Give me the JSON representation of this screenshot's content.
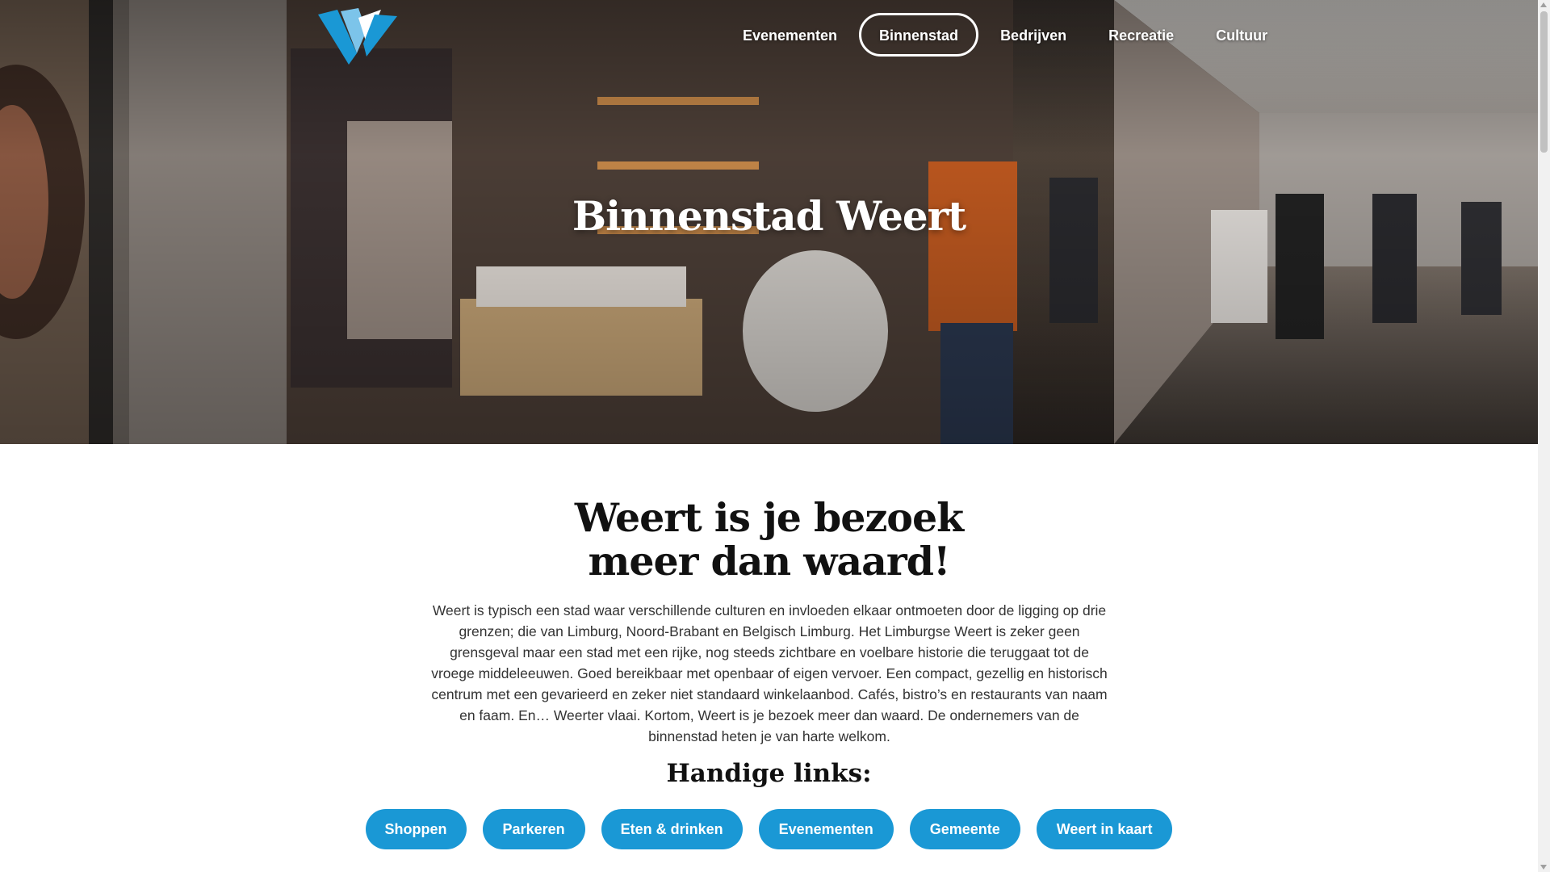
{
  "hero": {
    "title": "Binnenstad Weert",
    "image": "shopping-street-photo"
  },
  "logo": {
    "icon": "weert-w-logo",
    "colors": [
      "#1a98d5",
      "#7cc4ea",
      "#ffffff"
    ]
  },
  "nav": {
    "items": [
      {
        "label": "Evenementen",
        "active": false
      },
      {
        "label": "Binnenstad",
        "active": true
      },
      {
        "label": "Bedrijven",
        "active": false
      },
      {
        "label": "Recreatie",
        "active": false
      },
      {
        "label": "Cultuur",
        "active": false
      }
    ]
  },
  "main": {
    "heading_line1": "Weert is je bezoek",
    "heading_line2": "meer dan waard!",
    "intro": "Weert is typisch een stad waar verschillende culturen en invloeden elkaar ontmoeten door de ligging op drie grenzen; die van Limburg, Noord-Brabant en Belgisch Limburg. Het Limburgse Weert is zeker geen grensgeval maar een stad met een rijke, nog steeds zichtbare en voelbare historie die teruggaat tot de vroege middeleeuwen. Goed bereikbaar met openbaar of eigen vervoer. Een compact, gezellig en historisch centrum met een gevarieerd en zeker niet standaard winkelaanbod. Cafés, bistro’s en restaurants van naam en faam. En… Weerter vlaai. Kortom, Weert is je bezoek meer dan waard. De ondernemers van de binnenstad heten je van harte welkom.",
    "links_title": "Handige links:",
    "links": [
      "Shoppen",
      "Parkeren",
      "Eten & drinken",
      "Evenementen",
      "Gemeente",
      "Weert in kaart"
    ]
  },
  "colors": {
    "accent": "#1a98d5",
    "text": "#111111"
  }
}
